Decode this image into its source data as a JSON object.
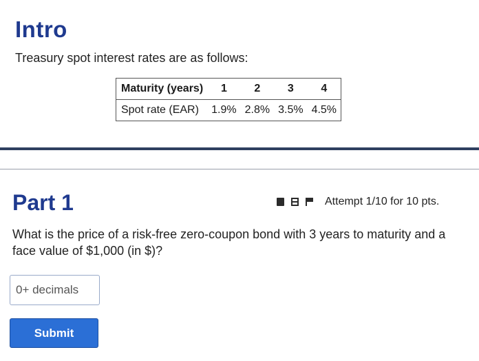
{
  "intro": {
    "title": "Intro",
    "text": "Treasury spot interest rates are as follows:"
  },
  "rates_table": {
    "header": [
      "Maturity (years)",
      "1",
      "2",
      "3",
      "4"
    ],
    "row": [
      "Spot rate (EAR)",
      "1.9%",
      "2.8%",
      "3.5%",
      "4.5%"
    ]
  },
  "part1": {
    "title": "Part 1",
    "attempt": "Attempt 1/10 for 10 pts.",
    "icons": [
      "book-icon",
      "calculator-icon",
      "flag-icon"
    ],
    "question": "What is the price of a risk-free zero-coupon bond with 3 years to maturity and a face value of $1,000 (in $)?",
    "input_placeholder": "0+ decimals",
    "submit_label": "Submit"
  },
  "colors": {
    "heading": "#1f3a8f",
    "submit": "#2b6fd6",
    "divider": "#2e3f60"
  }
}
